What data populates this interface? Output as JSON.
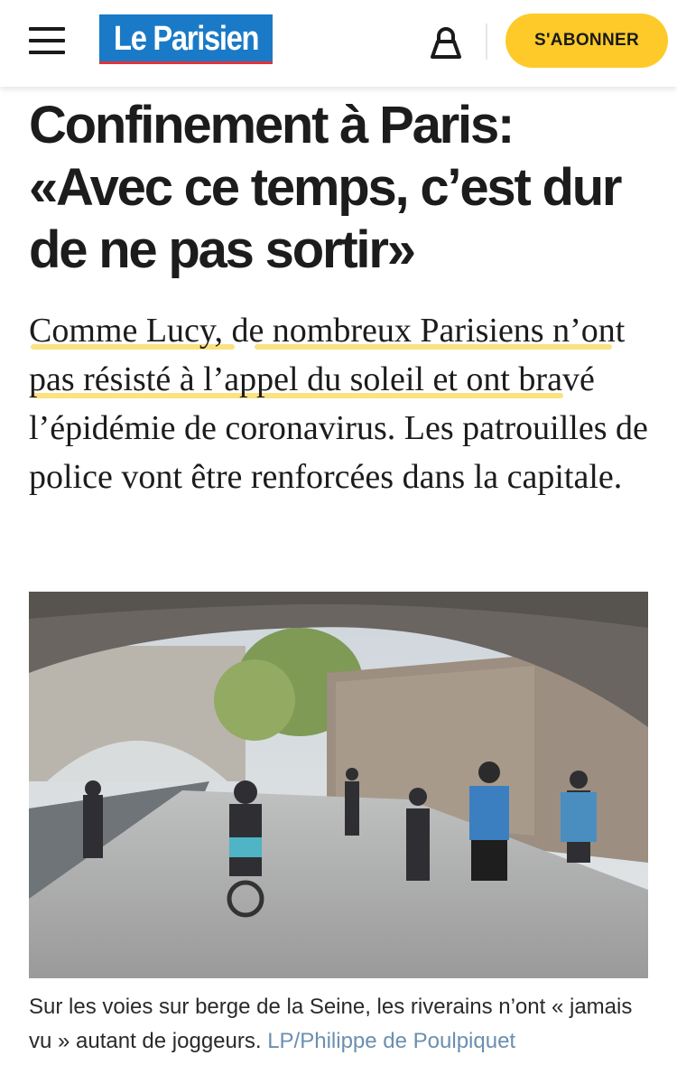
{
  "header": {
    "logo_text": "Le Parisien",
    "subscribe_label": "S'ABONNER",
    "icons": [
      "menu-icon",
      "user-icon"
    ],
    "colors": {
      "logo_bg": "#1a7ac7",
      "logo_underline": "#e0333a",
      "subscribe_bg": "#fdca29"
    }
  },
  "article": {
    "headline": "Confinement à Paris: «Avec ce temps, c’est dur de ne pas sortir»",
    "lead": {
      "seg1": "Comme Lucy",
      "seg2": ", ",
      "seg3": "de nombreux Parisiens",
      "seg4": "n’ont pas résisté à l’appel du soleil",
      "seg5": " et ont bravé l’épidémie de coronavirus. Les patrouilles de police vont être renforcées dans la capitale."
    },
    "caption": {
      "text": "Sur les voies sur berge de la Seine, les riverains n’ont « jamais vu » autant de joggeurs.",
      "credit": "LP/Philippe de Poulpiquet"
    },
    "highlight_color": "#fbe07a"
  }
}
